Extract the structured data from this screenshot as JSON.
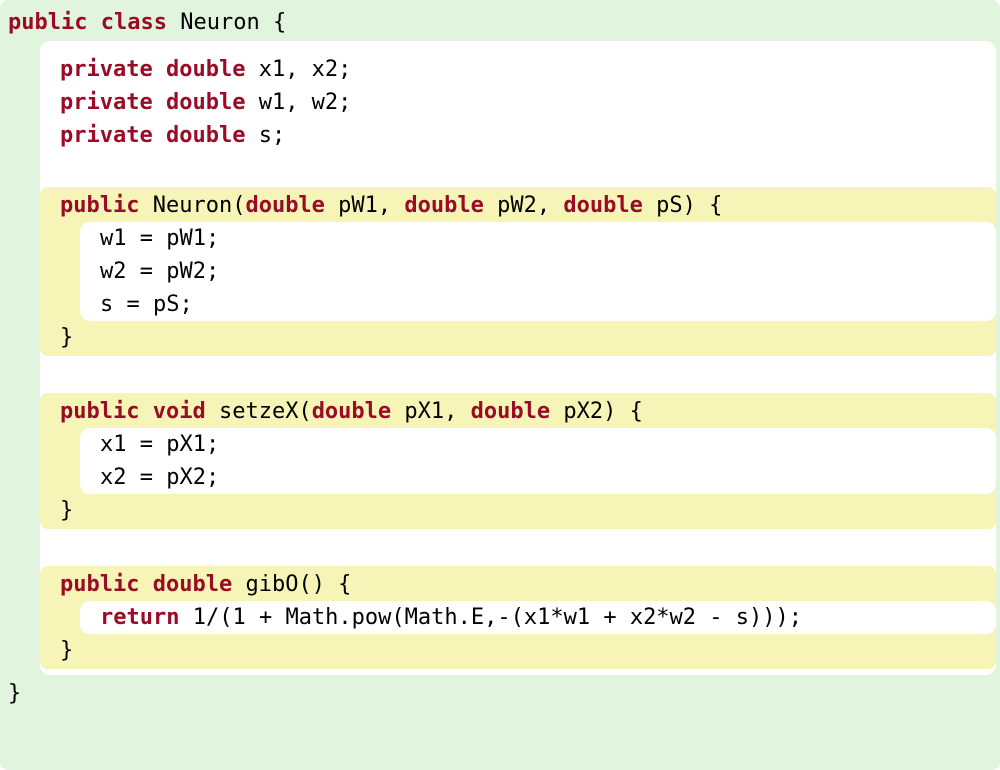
{
  "colors": {
    "bg_outer": "#e1f4dd",
    "bg_method": "#f6f4b7",
    "kw": "#9a0b26"
  },
  "class_decl": {
    "kw1": "public",
    "kw2": "class",
    "name": "Neuron",
    "open": " {",
    "close": "}"
  },
  "fields": [
    {
      "kw1": "private",
      "kw2": "double",
      "rest": " x1, x2;"
    },
    {
      "kw1": "private",
      "kw2": "double",
      "rest": " w1, w2;"
    },
    {
      "kw1": "private",
      "kw2": "double",
      "rest": " s;"
    }
  ],
  "ctor": {
    "kw1": "public",
    "name": " Neuron(",
    "p1kw": "double",
    "p1": " pW1, ",
    "p2kw": "double",
    "p2": " pW2, ",
    "p3kw": "double",
    "p3": " pS) {",
    "body": [
      "w1 = pW1;",
      "w2 = pW2;",
      "s = pS;"
    ],
    "close": "}"
  },
  "m2": {
    "kw1": "public",
    "kw2": "void",
    "name": " setzeX(",
    "p1kw": "double",
    "p1": " pX1, ",
    "p2kw": "double",
    "p2": " pX2) {",
    "body": [
      "x1 = pX1;",
      "x2 = pX2;"
    ],
    "close": "}"
  },
  "m3": {
    "kw1": "public",
    "kw2": "double",
    "name": " gibO() {",
    "retkw": "return",
    "ret": " 1/(1 + Math.pow(Math.E,-(x1*w1 + x2*w2 - s)));",
    "close": "}"
  }
}
